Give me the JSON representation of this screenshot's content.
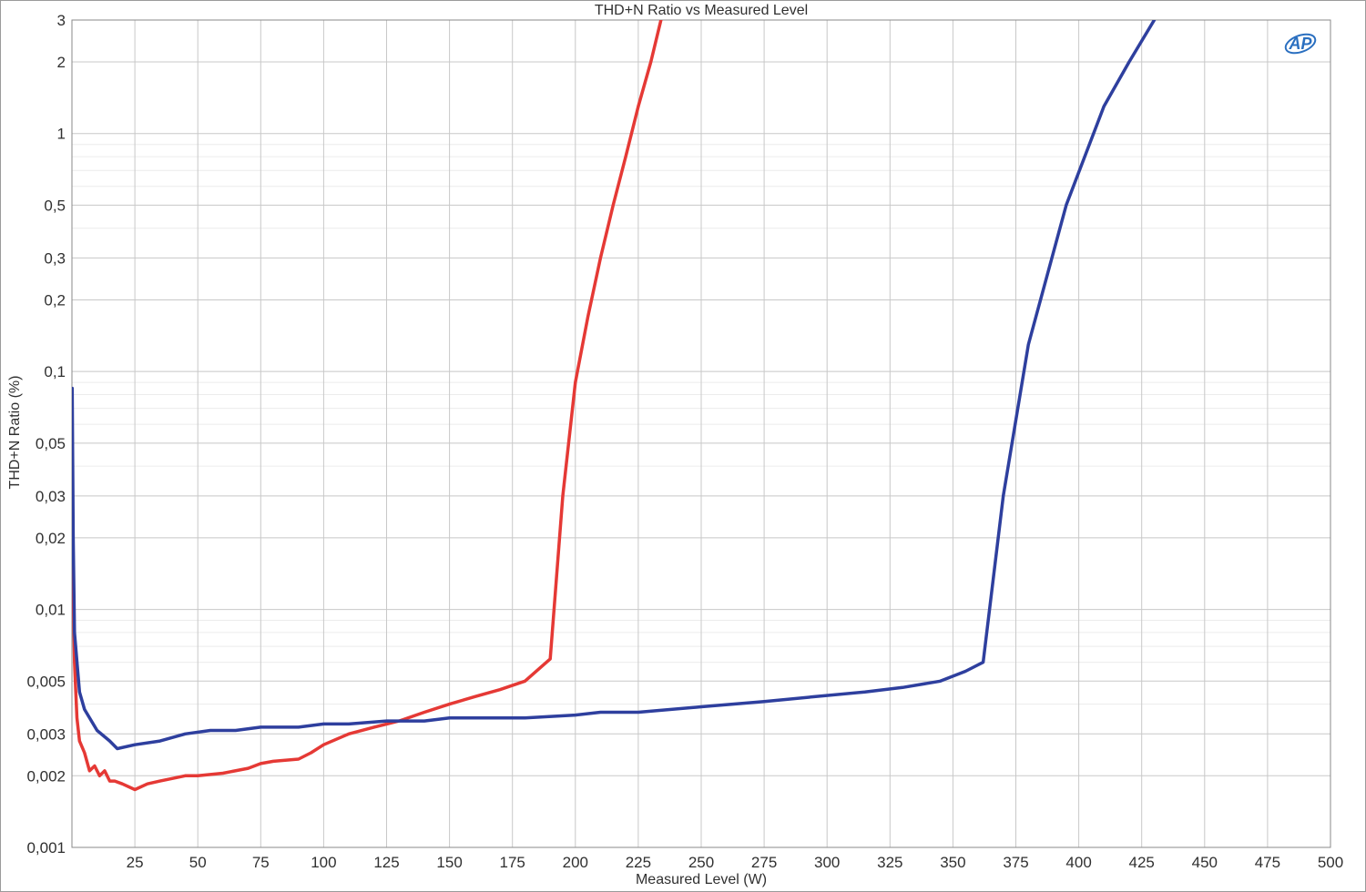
{
  "chart_data": {
    "type": "line",
    "title": "THD+N Ratio vs Measured Level",
    "xlabel": "Measured Level (W)",
    "ylabel": "THD+N Ratio (%)",
    "xlim": [
      0,
      500
    ],
    "ylim": [
      0.001,
      3
    ],
    "yscale": "log",
    "grid": true,
    "x_ticks": [
      25,
      50,
      75,
      100,
      125,
      150,
      175,
      200,
      225,
      250,
      275,
      300,
      325,
      350,
      375,
      400,
      425,
      450,
      475,
      500
    ],
    "x_tick_labels": [
      "25",
      "50",
      "75",
      "100",
      "125",
      "150",
      "175",
      "200",
      "225",
      "250",
      "275",
      "300",
      "325",
      "350",
      "375",
      "400",
      "425",
      "450",
      "475",
      "500"
    ],
    "y_ticks": [
      0.001,
      0.002,
      0.003,
      0.005,
      0.01,
      0.02,
      0.03,
      0.05,
      0.1,
      0.2,
      0.3,
      0.5,
      1,
      2,
      3
    ],
    "y_tick_labels": [
      "0,001",
      "0,002",
      "0,003",
      "0,005",
      "0,01",
      "0,02",
      "0,03",
      "0,05",
      "0,1",
      "0,2",
      "0,3",
      "0,5",
      "1",
      "2",
      "3"
    ],
    "series": [
      {
        "color": "#e53935",
        "points": [
          [
            0.1,
            0.04
          ],
          [
            0.5,
            0.012
          ],
          [
            1,
            0.006
          ],
          [
            2,
            0.0035
          ],
          [
            3,
            0.0028
          ],
          [
            5,
            0.0025
          ],
          [
            7,
            0.0021
          ],
          [
            9,
            0.0022
          ],
          [
            11,
            0.002
          ],
          [
            13,
            0.0021
          ],
          [
            15,
            0.0019
          ],
          [
            17,
            0.0019
          ],
          [
            20,
            0.00185
          ],
          [
            25,
            0.00175
          ],
          [
            30,
            0.00185
          ],
          [
            35,
            0.0019
          ],
          [
            40,
            0.00195
          ],
          [
            45,
            0.002
          ],
          [
            50,
            0.002
          ],
          [
            60,
            0.00205
          ],
          [
            70,
            0.00215
          ],
          [
            75,
            0.00225
          ],
          [
            80,
            0.0023
          ],
          [
            90,
            0.00235
          ],
          [
            95,
            0.0025
          ],
          [
            100,
            0.0027
          ],
          [
            110,
            0.003
          ],
          [
            120,
            0.0032
          ],
          [
            130,
            0.0034
          ],
          [
            140,
            0.0037
          ],
          [
            150,
            0.004
          ],
          [
            160,
            0.0043
          ],
          [
            170,
            0.0046
          ],
          [
            180,
            0.005
          ],
          [
            190,
            0.0062
          ],
          [
            195,
            0.03
          ],
          [
            200,
            0.09
          ],
          [
            205,
            0.17
          ],
          [
            210,
            0.3
          ],
          [
            215,
            0.5
          ],
          [
            220,
            0.8
          ],
          [
            225,
            1.3
          ],
          [
            230,
            2.0
          ],
          [
            234,
            3.0
          ]
        ]
      },
      {
        "color": "#2e3f9e",
        "points": [
          [
            0.1,
            0.085
          ],
          [
            0.5,
            0.02
          ],
          [
            1,
            0.008
          ],
          [
            3,
            0.0045
          ],
          [
            5,
            0.0038
          ],
          [
            10,
            0.0031
          ],
          [
            15,
            0.0028
          ],
          [
            18,
            0.0026
          ],
          [
            25,
            0.0027
          ],
          [
            35,
            0.0028
          ],
          [
            45,
            0.003
          ],
          [
            55,
            0.0031
          ],
          [
            65,
            0.0031
          ],
          [
            75,
            0.0032
          ],
          [
            90,
            0.0032
          ],
          [
            100,
            0.0033
          ],
          [
            110,
            0.0033
          ],
          [
            125,
            0.0034
          ],
          [
            140,
            0.0034
          ],
          [
            150,
            0.0035
          ],
          [
            165,
            0.0035
          ],
          [
            180,
            0.0035
          ],
          [
            200,
            0.0036
          ],
          [
            210,
            0.0037
          ],
          [
            225,
            0.0037
          ],
          [
            250,
            0.0039
          ],
          [
            275,
            0.0041
          ],
          [
            295,
            0.0043
          ],
          [
            315,
            0.0045
          ],
          [
            330,
            0.0047
          ],
          [
            345,
            0.005
          ],
          [
            355,
            0.0055
          ],
          [
            362,
            0.006
          ],
          [
            370,
            0.03
          ],
          [
            380,
            0.13
          ],
          [
            395,
            0.5
          ],
          [
            410,
            1.3
          ],
          [
            420,
            2.0
          ],
          [
            430,
            3.0
          ]
        ]
      }
    ]
  },
  "logo": {
    "text": "AP",
    "color": "#2a6fc0"
  }
}
